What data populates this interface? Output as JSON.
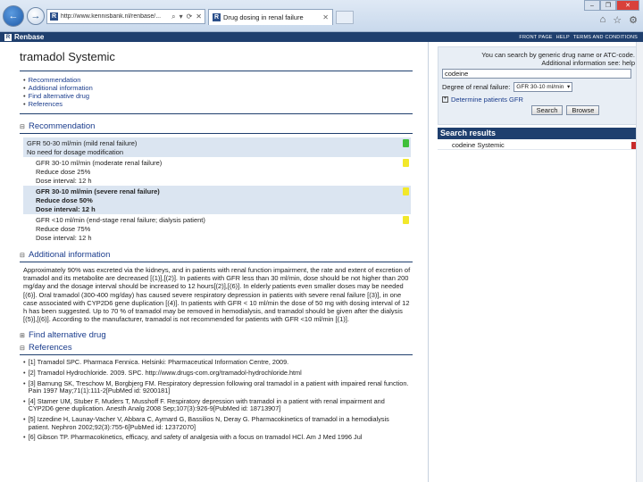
{
  "browser": {
    "url": "http://www.kennisbank.nl/renbase/...",
    "tab_title": "Drug dosing in renal failure",
    "tab_favicon": "R",
    "nav_back": "←",
    "nav_forward": "→",
    "addr_icons": [
      "⌕",
      "▾",
      "⟳",
      "✕"
    ],
    "tab_close": "✕",
    "window_buttons": [
      "–",
      "❐",
      "✕"
    ],
    "tool_icons": [
      "⌂",
      "☆",
      "⚙"
    ]
  },
  "site": {
    "logo_mark": "R",
    "logo": "Renbase",
    "topnav": [
      "FRONT PAGE",
      "HELP",
      "TERMS AND CONDITIONS"
    ]
  },
  "page": {
    "title": "tramadol Systemic",
    "toc": [
      "Recommendation",
      "Additional information",
      "Find alternative drug",
      "References"
    ],
    "bullet": "•",
    "collapse_marker": "⊟",
    "expand_marker": "⊞"
  },
  "recommendation": {
    "heading": "Recommendation",
    "rows": [
      {
        "title": "GFR 50-30 ml/min (mild renal failure)",
        "lines": [
          "No need for dosage modification"
        ],
        "badge": "green",
        "badge_color": "#3fbf3a",
        "shaded": true
      },
      {
        "title": "GFR 30-10 ml/min (moderate renal failure)",
        "lines": [
          "Reduce dose 25%",
          "Dose interval: 12 h"
        ],
        "badge": "yellow",
        "badge_color": "#f2e82a",
        "shaded": false
      },
      {
        "title": "GFR 30-10 ml/min (severe renal failure)",
        "lines": [
          "Reduce dose 50%",
          "Dose interval: 12 h"
        ],
        "badge": "yellow",
        "badge_color": "#f2e82a",
        "shaded": true
      },
      {
        "title": "GFR <10 ml/min (end-stage renal failure; dialysis patient)",
        "lines": [
          "Reduce dose 75%",
          "Dose interval: 12 h"
        ],
        "badge": "yellow",
        "badge_color": "#f2e82a",
        "shaded": false
      }
    ]
  },
  "additional": {
    "heading": "Additional information",
    "text": "Approximately 90% was excreted via the kidneys, and in patients with renal function impairment, the rate and extent of excretion of tramadol and its metabolite are decreased [(1)],[(2)]. In patients with GFR less than 30 ml/min, dose should be not higher than 200 mg/day and the dosage interval should be increased to 12 hours[(2)],[(6)]. In elderly patients even smaller doses may be needed [(6)]. Oral tramadol (300-400 mg/day) has caused severe respiratory depression in patients with severe renal failure [(3)], in one case associated with CYP2D6 gene duplication [(4)]. In patients with GFR < 10 ml/min the dose of 50 mg with dosing interval of 12 h has been suggested. Up to 70 % of tramadol may be removed in hemodialysis, and tramadol should be given after the dialysis [(5)],[(6)]. According to the manufacturer, tramadol is not recommended for patients with GFR <10 ml/min [(1)]."
  },
  "alternative": {
    "heading": "Find alternative drug"
  },
  "references": {
    "heading": "References",
    "items": [
      "[1] Tramadol SPC. Pharmaca Fennica. Helsinki: Pharmaceutical Information Centre, 2009.",
      "[2] Tramadol Hydrochloride. 2009. SPC. http://www.drugs-com.org/tramadol-hydrochloride.html",
      "[3] Barnung SK, Treschow M, Borgbjerg FM. Respiratory depression following oral tramadol in a patient with impaired renal function. Pain 1997 May;71(1):111-2[PubMed id: 9200181]",
      "[4] Stamer UM, Stuber F, Muders T, Musshoff F. Respiratory depression with tramadol in a patient with renal impairment and CYP2D6 gene duplication. Anesth Analg 2008 Sep;107(3):926-9[PubMed id: 18713907]",
      "[5] Izzedine H, Launay-Vacher V, Abbara C, Aymard G, Bassilios N, Deray G. Pharmacokinetics of tramadol in a hemodialysis patient. Nephron 2002;92(3):755-6[PubMed id: 12372070]",
      "[6] Gibson TP. Pharmacokinetics, efficacy, and safety of analgesia with a focus on tramadol HCl. Am J Med 1996 Jul"
    ]
  },
  "sidebar": {
    "hint_line1": "You can search by generic drug name or ATC-code.",
    "hint_line2": "Additional information see: help",
    "search_value": "codeine",
    "renal_label": "Degree of renal failure:",
    "renal_value": "GFR 30-10 ml/min",
    "select_arrow": "▾",
    "plus_sign": "+",
    "determine_label": "Determine patients GFR",
    "search_button": "Search",
    "browse_button": "Browse",
    "results_heading": "Search results",
    "result_item": "codeine Systemic",
    "result_flag_color": "#c82a2a"
  }
}
